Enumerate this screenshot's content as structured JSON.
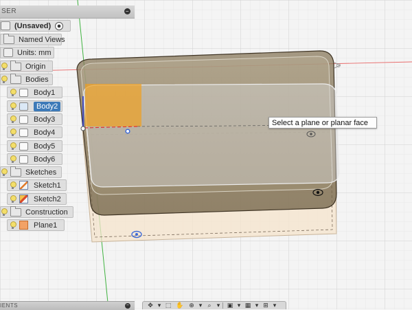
{
  "browser": {
    "title_fragment": "SER",
    "collapse_glyph": "−",
    "items": [
      {
        "label": "(Unsaved)",
        "icon": "document-icon"
      },
      {
        "label": "Named Views",
        "icon": "folder-icon"
      },
      {
        "label": "Units: mm",
        "icon": "document-icon"
      },
      {
        "label": "Origin",
        "icon": "folder-icon"
      },
      {
        "label": "Bodies",
        "icon": "folder-icon"
      },
      {
        "label": "Body1",
        "icon": "body-icon"
      },
      {
        "label": "Body2",
        "icon": "body-icon",
        "selected": true
      },
      {
        "label": "Body3",
        "icon": "body-icon"
      },
      {
        "label": "Body4",
        "icon": "body-icon"
      },
      {
        "label": "Body5",
        "icon": "body-icon"
      },
      {
        "label": "Body6",
        "icon": "body-icon"
      },
      {
        "label": "Sketches",
        "icon": "folder-icon"
      },
      {
        "label": "Sketch1",
        "icon": "sketch-icon"
      },
      {
        "label": "Sketch2",
        "icon": "sketch-warning-icon"
      },
      {
        "label": "Construction",
        "icon": "folder-icon"
      },
      {
        "label": "Plane1",
        "icon": "plane-icon"
      }
    ]
  },
  "tooltip": {
    "text": "Select a plane or planar face"
  },
  "bottom_panel": {
    "title_fragment": "IENTS",
    "collapse_glyph": "−"
  },
  "nav_toolbar": {
    "buttons": [
      {
        "name": "orbit-icon",
        "glyph": "✥"
      },
      {
        "name": "dropdown-icon",
        "glyph": "▾"
      },
      {
        "name": "look-at-icon",
        "glyph": "⬚"
      },
      {
        "name": "pan-icon",
        "glyph": "✋"
      },
      {
        "name": "zoom-icon",
        "glyph": "⊕"
      },
      {
        "name": "dropdown-icon",
        "glyph": "▾"
      },
      {
        "name": "fit-icon",
        "glyph": "⌕"
      },
      {
        "name": "dropdown-icon",
        "glyph": "▾"
      },
      {
        "name": "display-settings-icon",
        "glyph": "▣"
      },
      {
        "name": "dropdown-icon",
        "glyph": "▾"
      },
      {
        "name": "grid-icon",
        "glyph": "▦"
      },
      {
        "name": "dropdown-icon",
        "glyph": "▾"
      },
      {
        "name": "viewports-icon",
        "glyph": "⊞"
      },
      {
        "name": "dropdown-icon",
        "glyph": "▾"
      }
    ]
  },
  "colors": {
    "grid_background": "#f4f4f4",
    "grid_line": "#d9d9d9",
    "x_axis": "#e05050",
    "y_axis": "#40b040",
    "selection": "#3d7ab8",
    "body_fill": "#9a8a6a",
    "sketch_fill": "#f6e6d2",
    "highlight": "#f0a020"
  }
}
